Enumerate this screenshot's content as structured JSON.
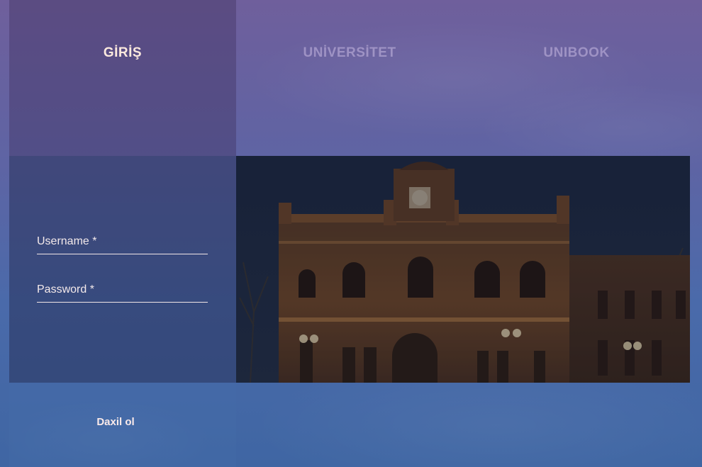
{
  "nav": {
    "tabs": [
      {
        "label": "GİRİŞ",
        "active": true
      },
      {
        "label": "UNİVERSİTET",
        "active": false
      },
      {
        "label": "UNIBOOK",
        "active": false
      }
    ]
  },
  "login": {
    "username_label": "Username *",
    "password_label": "Password *",
    "submit_label": "Daxil ol"
  },
  "hero_image": {
    "subject": "university-building-night"
  },
  "colors": {
    "active_tab_text": "#fce9de",
    "inactive_tab_text": "#b7a8d6",
    "field_line": "#f1e6e6"
  }
}
